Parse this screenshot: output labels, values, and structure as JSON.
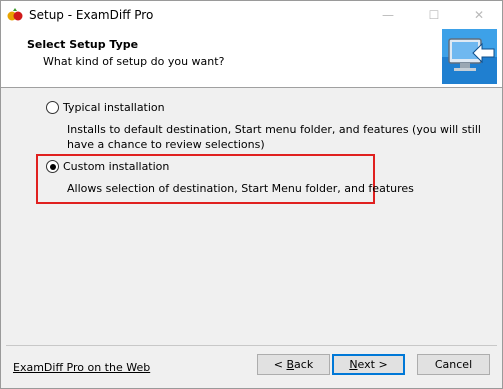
{
  "window": {
    "title": "Setup - ExamDiff Pro",
    "controls": {
      "minimize": "—",
      "maximize": "☐",
      "close": "✕"
    }
  },
  "header": {
    "title": "Select Setup Type",
    "subtitle": "What kind of setup do you want?"
  },
  "options": [
    {
      "label": "Typical installation",
      "description": "Installs to default destination, Start menu folder, and features (you will still have a chance to review selections)",
      "checked": false
    },
    {
      "label": "Custom installation",
      "description": "Allows selection of destination, Start Menu folder, and features",
      "checked": true
    }
  ],
  "footer": {
    "link": "ExamDiff Pro on the Web",
    "buttons": {
      "back_prefix": "< ",
      "back_hotkey": "B",
      "back_rest": "ack",
      "next_hotkey": "N",
      "next_rest": "ext >",
      "cancel": "Cancel"
    }
  },
  "colors": {
    "highlight_border": "#e0201f",
    "default_button_border": "#0078d7"
  }
}
